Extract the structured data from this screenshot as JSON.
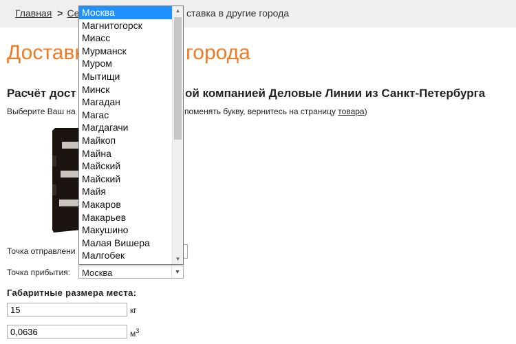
{
  "breadcrumb": {
    "home": "Главная",
    "section": "Се",
    "current": "ставка в другие города"
  },
  "page_title_left": "Доставк",
  "page_title_right": "города",
  "subtitle_left": "Расчёт дост",
  "subtitle_right": "ой компанией Деловые Линии из Санкт-Петербурга",
  "hint": {
    "left": "Выберите Ваш на",
    "right_prefix": "поменять букву, вернитесь на страницу ",
    "link": "товара",
    "right_suffix": ")"
  },
  "form": {
    "departure_label": "Точка отправлени",
    "arrival_label": "Точка прибытия:",
    "arrival_value": "Москва",
    "dimensions_title": "Габаритные размера места:",
    "weight_value": "15",
    "weight_unit": "кг",
    "volume_value": "0,0636",
    "volume_unit": "м",
    "volume_unit_sup": "3"
  },
  "dropdown": {
    "selected_index": 0,
    "options": [
      "Москва",
      "Магнитогорск",
      "Миасс",
      "Мурманск",
      "Муром",
      "Мытищи",
      "Минск",
      "Магадан",
      "Магас",
      "Магдагачи",
      "Майкоп",
      "Майна",
      "Майский",
      "Майский",
      "Майя",
      "Макаров",
      "Макарьев",
      "Макушино",
      "Малая Вишера",
      "Малгобек"
    ]
  },
  "colors": {
    "title_orange": "#f07a24",
    "selection_blue": "#1e90ff",
    "crumb_bg": "#efefef"
  },
  "icons": {
    "breadcrumb_separator": "chevron-right-icon",
    "select_arrow": "chevron-down-icon"
  }
}
